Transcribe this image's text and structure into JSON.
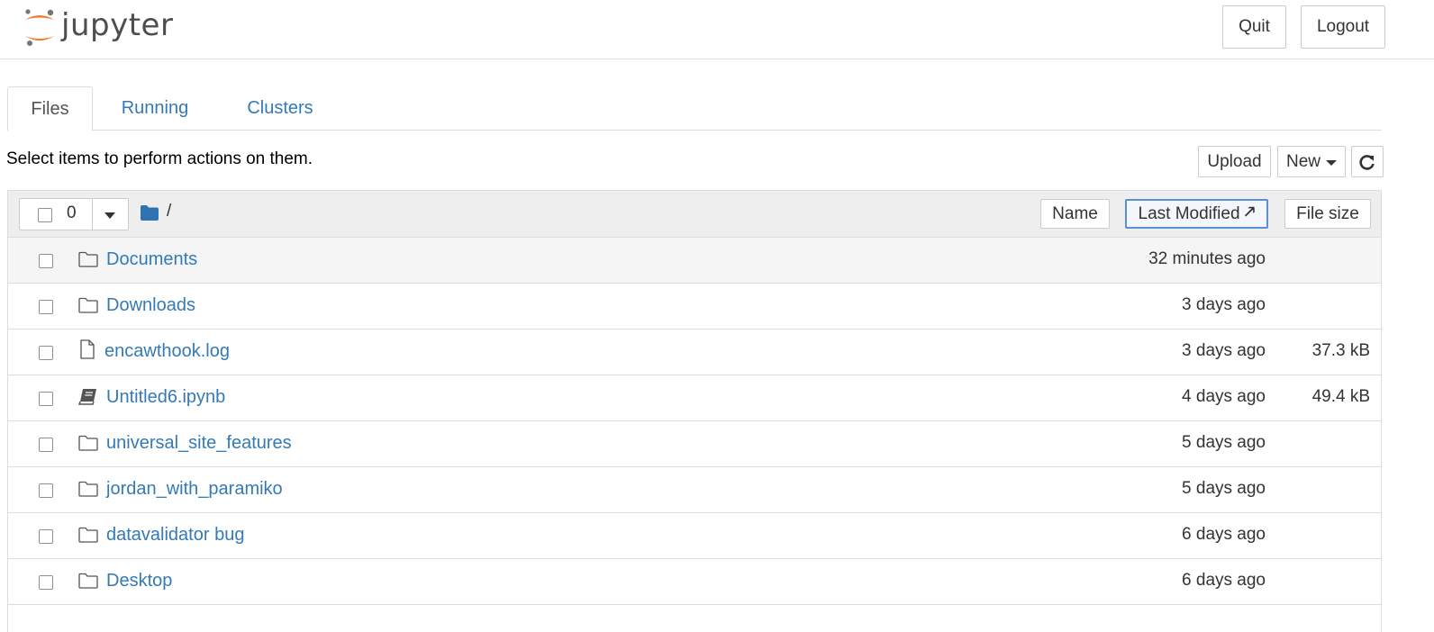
{
  "header": {
    "logo_text": "jupyter",
    "quit_label": "Quit",
    "logout_label": "Logout"
  },
  "tabs": [
    {
      "label": "Files",
      "active": true
    },
    {
      "label": "Running",
      "active": false
    },
    {
      "label": "Clusters",
      "active": false
    }
  ],
  "toolbar": {
    "hint": "Select items to perform actions on them.",
    "upload_label": "Upload",
    "new_label": "New"
  },
  "list_header": {
    "selected_count": "0",
    "path": "/",
    "sort_name_label": "Name",
    "sort_modified_label": "Last Modified",
    "sort_size_label": "File size"
  },
  "items": [
    {
      "type": "folder",
      "name": "Documents",
      "modified": "32 minutes ago",
      "size": ""
    },
    {
      "type": "folder",
      "name": "Downloads",
      "modified": "3 days ago",
      "size": ""
    },
    {
      "type": "file",
      "name": "encawthook.log",
      "modified": "3 days ago",
      "size": "37.3 kB"
    },
    {
      "type": "notebook",
      "name": "Untitled6.ipynb",
      "modified": "4 days ago",
      "size": "49.4 kB"
    },
    {
      "type": "folder",
      "name": "universal_site_features",
      "modified": "5 days ago",
      "size": ""
    },
    {
      "type": "folder",
      "name": "jordan_with_paramiko",
      "modified": "5 days ago",
      "size": ""
    },
    {
      "type": "folder",
      "name": "datavalidator bug",
      "modified": "6 days ago",
      "size": ""
    },
    {
      "type": "folder",
      "name": "Desktop",
      "modified": "6 days ago",
      "size": ""
    }
  ],
  "colors": {
    "link": "#337ab7",
    "logo_orange": "#f37726",
    "border": "#dddddd",
    "sort_active": "#5b8fd4"
  }
}
